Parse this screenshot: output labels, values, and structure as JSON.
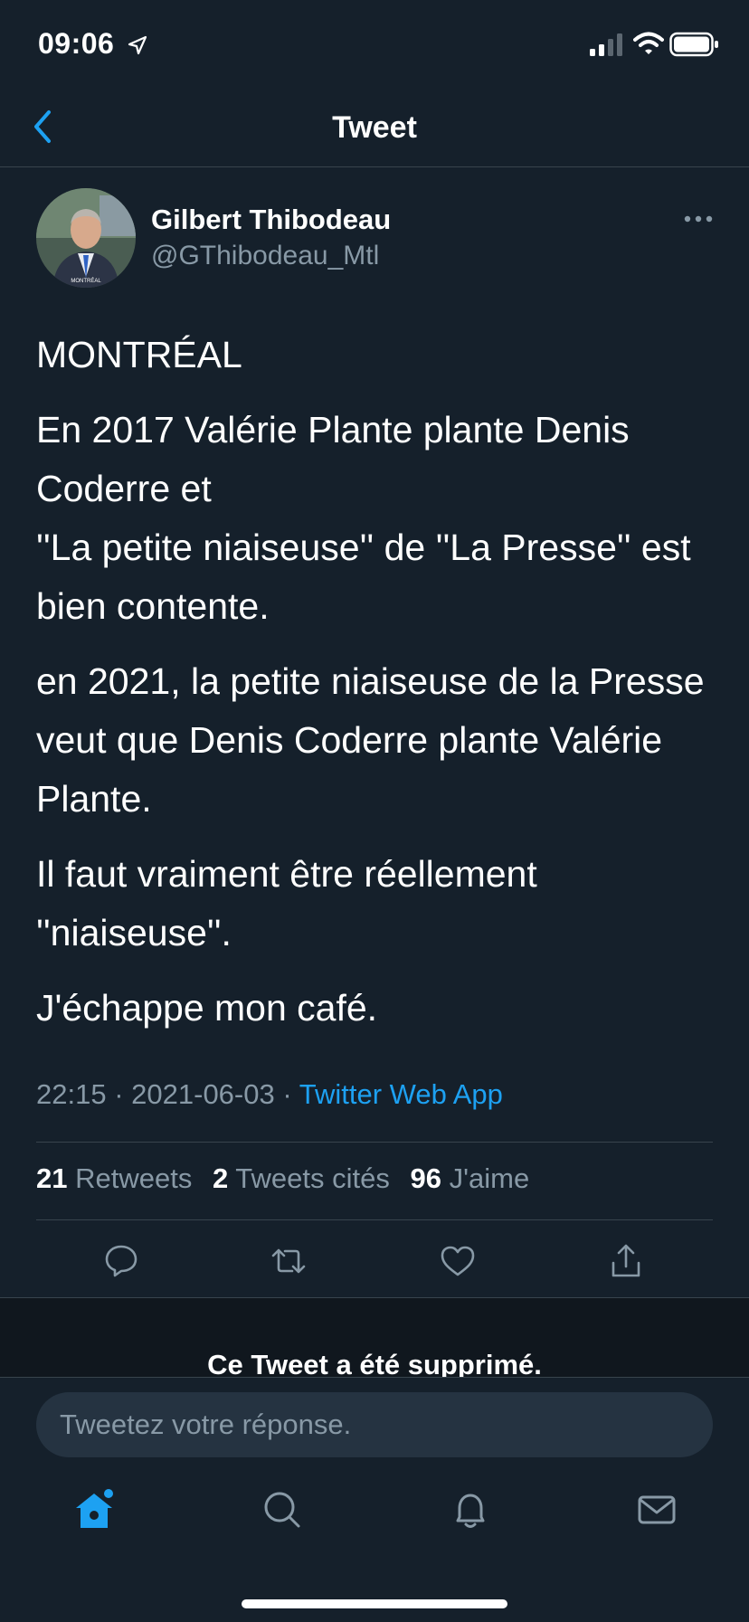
{
  "status_bar": {
    "time": "09:06"
  },
  "nav": {
    "title": "Tweet"
  },
  "author": {
    "name": "Gilbert Thibodeau",
    "handle": "@GThibodeau_Mtl",
    "avatar_caption": "MONTRÉAL"
  },
  "tweet": {
    "paragraphs": [
      "MONTRÉAL",
      "En 2017 Valérie Plante plante Denis Coderre et\n''La petite niaiseuse'' de ''La Presse'' est bien contente.",
      "en 2021, la petite niaiseuse de la Presse veut que Denis Coderre plante Valérie Plante.",
      "Il faut vraiment être réellement ''niaiseuse''.",
      "J'échappe mon café."
    ],
    "time": "22:15",
    "date": "2021-06-03",
    "source": "Twitter Web App",
    "separator": "·"
  },
  "stats": {
    "retweets_count": "21",
    "retweets_label": "Retweets",
    "quotes_count": "2",
    "quotes_label": "Tweets cités",
    "likes_count": "96",
    "likes_label": "J'aime"
  },
  "deleted_notice": "Ce Tweet a été supprimé.",
  "reply": {
    "placeholder": "Tweetez votre réponse."
  },
  "colors": {
    "background": "#15202b",
    "accent": "#1da1f2",
    "secondary_text": "#8899a6",
    "divider": "#38444d"
  },
  "icons": {
    "actions": [
      "reply-icon",
      "retweet-icon",
      "like-icon",
      "share-icon"
    ],
    "tabs": [
      "home-icon",
      "search-icon",
      "notifications-icon",
      "messages-icon"
    ]
  }
}
